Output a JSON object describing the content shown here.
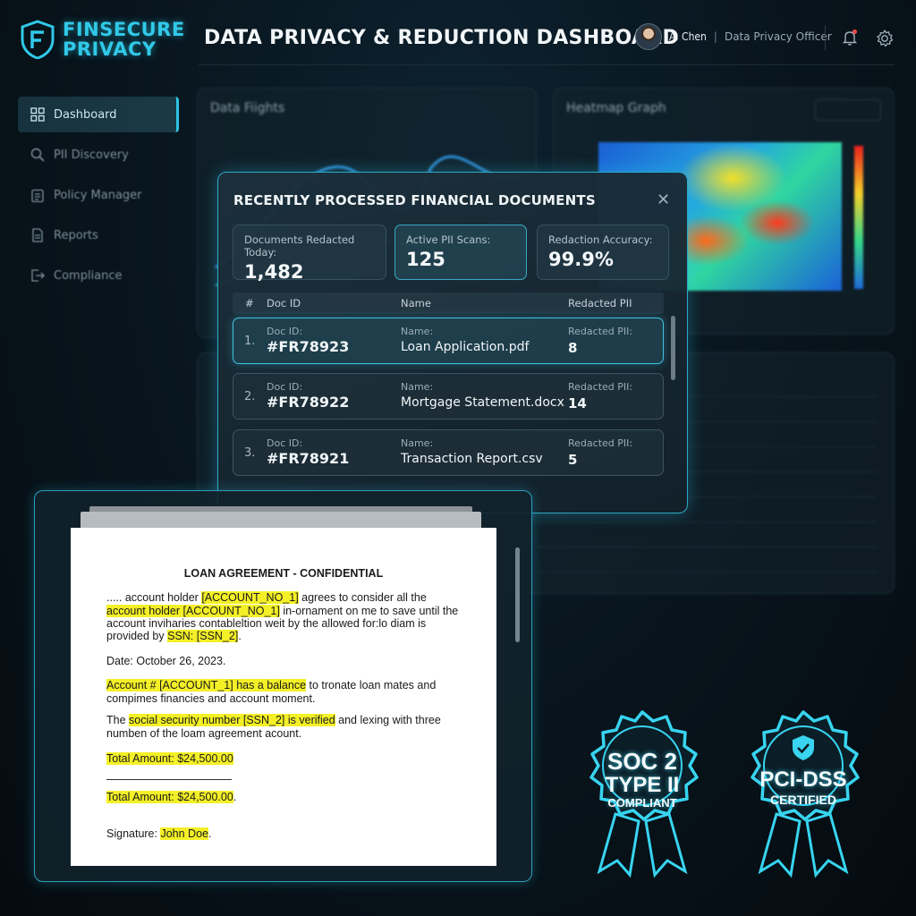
{
  "brand": {
    "line1": "FINSECURE",
    "line2": "PRIVACY",
    "accent": "#31c9e8"
  },
  "header": {
    "title": "DATA PRIVACY & REDUCTION DASHBOARD",
    "user_name": "A. Chen",
    "user_separator": "|",
    "user_role": "Data Privacy Officer"
  },
  "sidebar": {
    "items": [
      {
        "label": "Dashboard",
        "icon": "grid-icon",
        "active": true
      },
      {
        "label": "PII Discovery",
        "icon": "search-icon"
      },
      {
        "label": "Policy Manager",
        "icon": "clipboard-icon"
      },
      {
        "label": "Reports",
        "icon": "document-icon"
      },
      {
        "label": "Compliance",
        "icon": "exit-icon"
      }
    ]
  },
  "panels": {
    "left_title": "Data Fiights",
    "right_title": "Heatmap Graph"
  },
  "modal": {
    "title": "RECENTLY PROCESSED FINANCIAL DOCUMENTS",
    "close_glyph": "✕",
    "stats": [
      {
        "label": "Documents Redacted Today:",
        "value": "1,482"
      },
      {
        "label": "Active PII Scans:",
        "value": "125"
      },
      {
        "label": "Redaction Accuracy:",
        "value": "99.9%"
      }
    ],
    "columns": {
      "num": "#",
      "id": "Doc ID",
      "name": "Name",
      "pii": "Redacted PII"
    },
    "field_labels": {
      "id": "Doc ID:",
      "name": "Name:",
      "pii": "Redacted PII:"
    },
    "rows": [
      {
        "num": "1.",
        "id": "#FR78923",
        "name": "Loan Application.pdf",
        "pii": "8"
      },
      {
        "num": "2.",
        "id": "#FR78922",
        "name": "Mortgage Statement.docx",
        "pii": "14"
      },
      {
        "num": "3.",
        "id": "#FR78921",
        "name": "Transaction Report.csv",
        "pii": "5"
      }
    ]
  },
  "document": {
    "heading": "LOAN AGREEMENT - CONFIDENTIAL",
    "l1a": "..... account holder ",
    "l1b": "[ACCOUNT_NO_1]",
    "l1c": " agrees to consider all the",
    "l2a": "account holder [ACCOUNT_NO_1]",
    "l2b": " in-ornament on me to save until the",
    "l3": "account inviharies contableltion weit by the allowed for:lo diam is",
    "l4a": "provided by ",
    "l4b": "SSN: [SSN_2]",
    "l4c": ".",
    "date": "Date: October 26, 2023.",
    "l6a": "Account # [ACCOUNT_1] has a balance",
    "l6b": " to tronate loan mates and",
    "l7": "compimes financies and account moment.",
    "l8a": "The ",
    "l8b": "social security number [SSN_2] is verified",
    "l8c": " and lexing with three",
    "l9": "numben of the loam agreement acount.",
    "total1": "Total Amount: $24,500.00",
    "total2": "Total Amount: $24,500.00",
    "total2_end": ".",
    "sig_a": "Signature: ",
    "sig_b": "John Doe",
    "sig_c": "."
  },
  "badges": [
    {
      "l1": "SOC 2",
      "l2": "TYPE II",
      "l3": "COMPLIANT"
    },
    {
      "l1": "PCI-DSS",
      "l2": "CERTIFIED"
    }
  ]
}
